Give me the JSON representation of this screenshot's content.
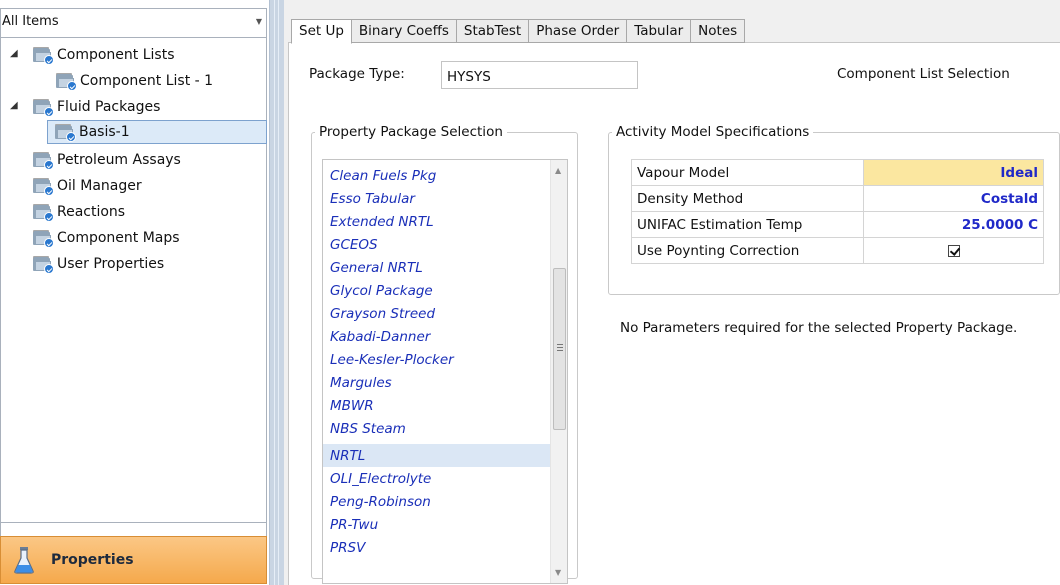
{
  "navigator": {
    "dropdown_value": "All Items",
    "tree": [
      {
        "label": "Component Lists",
        "expanded": true,
        "level": 0
      },
      {
        "label": "Component List - 1",
        "level": 1
      },
      {
        "label": "Fluid Packages",
        "expanded": true,
        "level": 0
      },
      {
        "label": "Basis-1",
        "level": 1,
        "selected": true
      },
      {
        "label": "Petroleum Assays",
        "level": 0
      },
      {
        "label": "Oil Manager",
        "level": 0
      },
      {
        "label": "Reactions",
        "level": 0
      },
      {
        "label": "Component Maps",
        "level": 0
      },
      {
        "label": "User Properties",
        "level": 0
      }
    ],
    "properties_button": "Properties"
  },
  "tabs": [
    {
      "label": "Set Up",
      "active": true
    },
    {
      "label": "Binary Coeffs"
    },
    {
      "label": "StabTest"
    },
    {
      "label": "Phase Order"
    },
    {
      "label": "Tabular"
    },
    {
      "label": "Notes"
    }
  ],
  "setup": {
    "package_type_label": "Package Type:",
    "package_type_value": "HYSYS",
    "component_list_selection_label": "Component List Selection",
    "property_package_group": "Property Package Selection",
    "property_packages": [
      "Clean Fuels Pkg",
      "Esso Tabular",
      "Extended NRTL",
      "GCEOS",
      "General NRTL",
      "Glycol Package",
      "Grayson Streed",
      "Kabadi-Danner",
      "Lee-Kesler-Plocker",
      "Margules",
      "MBWR",
      "NBS Steam",
      "NRTL",
      "OLI_Electrolyte",
      "Peng-Robinson",
      "PR-Twu",
      "PRSV"
    ],
    "selected_package": "NRTL",
    "activity_model_group": "Activity Model Specifications",
    "activity_model": [
      {
        "label": "Vapour Model",
        "value": "Ideal"
      },
      {
        "label": "Density Method",
        "value": "Costald"
      },
      {
        "label": "UNIFAC Estimation Temp",
        "value": "25.0000 C"
      },
      {
        "label": "Use Poynting Correction",
        "checked": true
      }
    ],
    "parameters_message": "No Parameters required for the selected Property Package."
  },
  "colors": {
    "package_text": "#1a2fb8",
    "value_text": "#2029c8",
    "highlight_cell": "#fbe7a0",
    "properties_button": "#f5a94c",
    "selection": "#dceaf8"
  }
}
